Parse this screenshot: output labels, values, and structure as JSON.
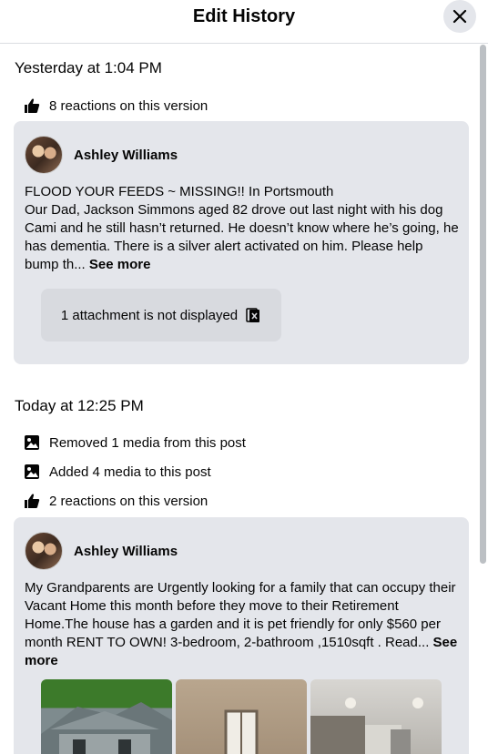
{
  "header": {
    "title": "Edit History"
  },
  "versions": [
    {
      "time": "Yesterday at 1:04 PM",
      "meta": [
        {
          "icon": "like-icon",
          "text": "8 reactions on this version"
        }
      ],
      "post": {
        "author": "Ashley Williams",
        "text": "FLOOD YOUR FEEDS ~ MISSING!! In Portsmouth\nOur Dad, Jackson Simmons aged 82 drove out last night with his dog Cami and he still hasn’t returned. He doesn’t know where he’s going, he has dementia. There is a silver alert activated on him. Please help bump th... ",
        "see_more": "See more",
        "attachment_notice": "1 attachment is not displayed"
      }
    },
    {
      "time": "Today at 12:25 PM",
      "meta": [
        {
          "icon": "media-icon",
          "text": "Removed 1 media from this post"
        },
        {
          "icon": "media-icon",
          "text": "Added 4 media to this post"
        },
        {
          "icon": "like-icon",
          "text": "2 reactions on this version"
        }
      ],
      "post": {
        "author": "Ashley Williams",
        "text": "My Grandparents are Urgently looking for a family that can occupy their Vacant Home this month before they move to their Retirement Home.The house has a garden and it is pet friendly for only $560 per month RENT TO OWN! 3-bedroom, 2-bathroom ,1510sqft . Read... ",
        "see_more": "See more"
      }
    }
  ]
}
